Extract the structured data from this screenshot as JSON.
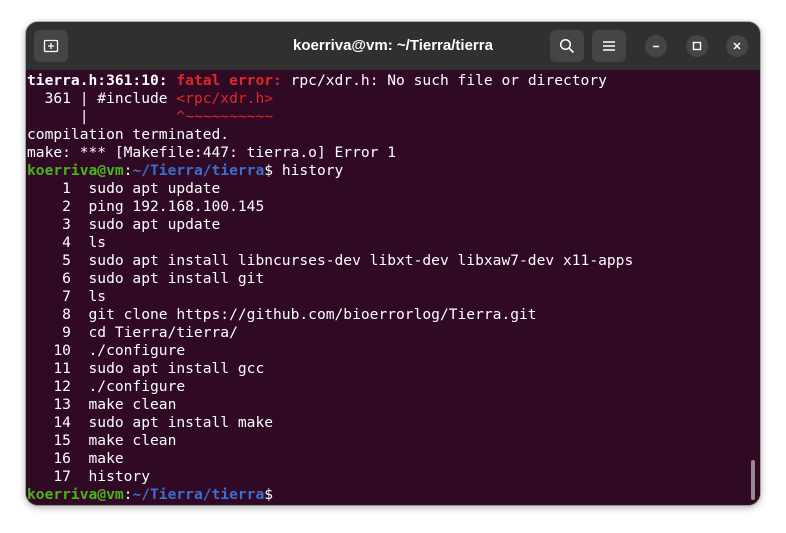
{
  "window": {
    "title": "koerriva@vm: ~/Tierra/tierra"
  },
  "titlebar": {
    "new_tab_icon": "new-tab-icon",
    "search_icon": "search-icon",
    "menu_icon": "hamburger-menu-icon",
    "minimize_icon": "minimize-icon",
    "maximize_icon": "maximize-icon",
    "close_icon": "close-icon"
  },
  "colors": {
    "terminal_bg": "#300a24",
    "titlebar_bg": "#303030",
    "error_red": "#e02828",
    "prompt_green": "#4ab51b",
    "path_blue": "#3a6fd0"
  },
  "terminal": {
    "error": {
      "location": "tierra.h:361:10:",
      "label": "fatal error:",
      "message": " rpc/xdr.h: No such file or directory"
    },
    "include_line": {
      "prefix": "  361 | #include ",
      "highlight": "<rpc/xdr.h>"
    },
    "caret_line": {
      "prefix": "      |          ",
      "caret": "^~~~~~~~~~~"
    },
    "compilation_terminated": "compilation terminated.",
    "make_error": "make: *** [Makefile:447: tierra.o] Error 1",
    "prompt": {
      "user_host": "koerriva@vm",
      "colon": ":",
      "path": "~/Tierra/tierra",
      "dollar": "$"
    },
    "command": " history",
    "history": [
      "    1  sudo apt update",
      "    2  ping 192.168.100.145",
      "    3  sudo apt update",
      "    4  ls",
      "    5  sudo apt install libncurses-dev libxt-dev libxaw7-dev x11-apps",
      "    6  sudo apt install git",
      "    7  ls",
      "    8  git clone https://github.com/bioerrorlog/Tierra.git",
      "    9  cd Tierra/tierra/",
      "   10  ./configure",
      "   11  sudo apt install gcc",
      "   12  ./configure",
      "   13  make clean",
      "   14  sudo apt install make",
      "   15  make clean",
      "   16  make",
      "   17  history"
    ]
  }
}
